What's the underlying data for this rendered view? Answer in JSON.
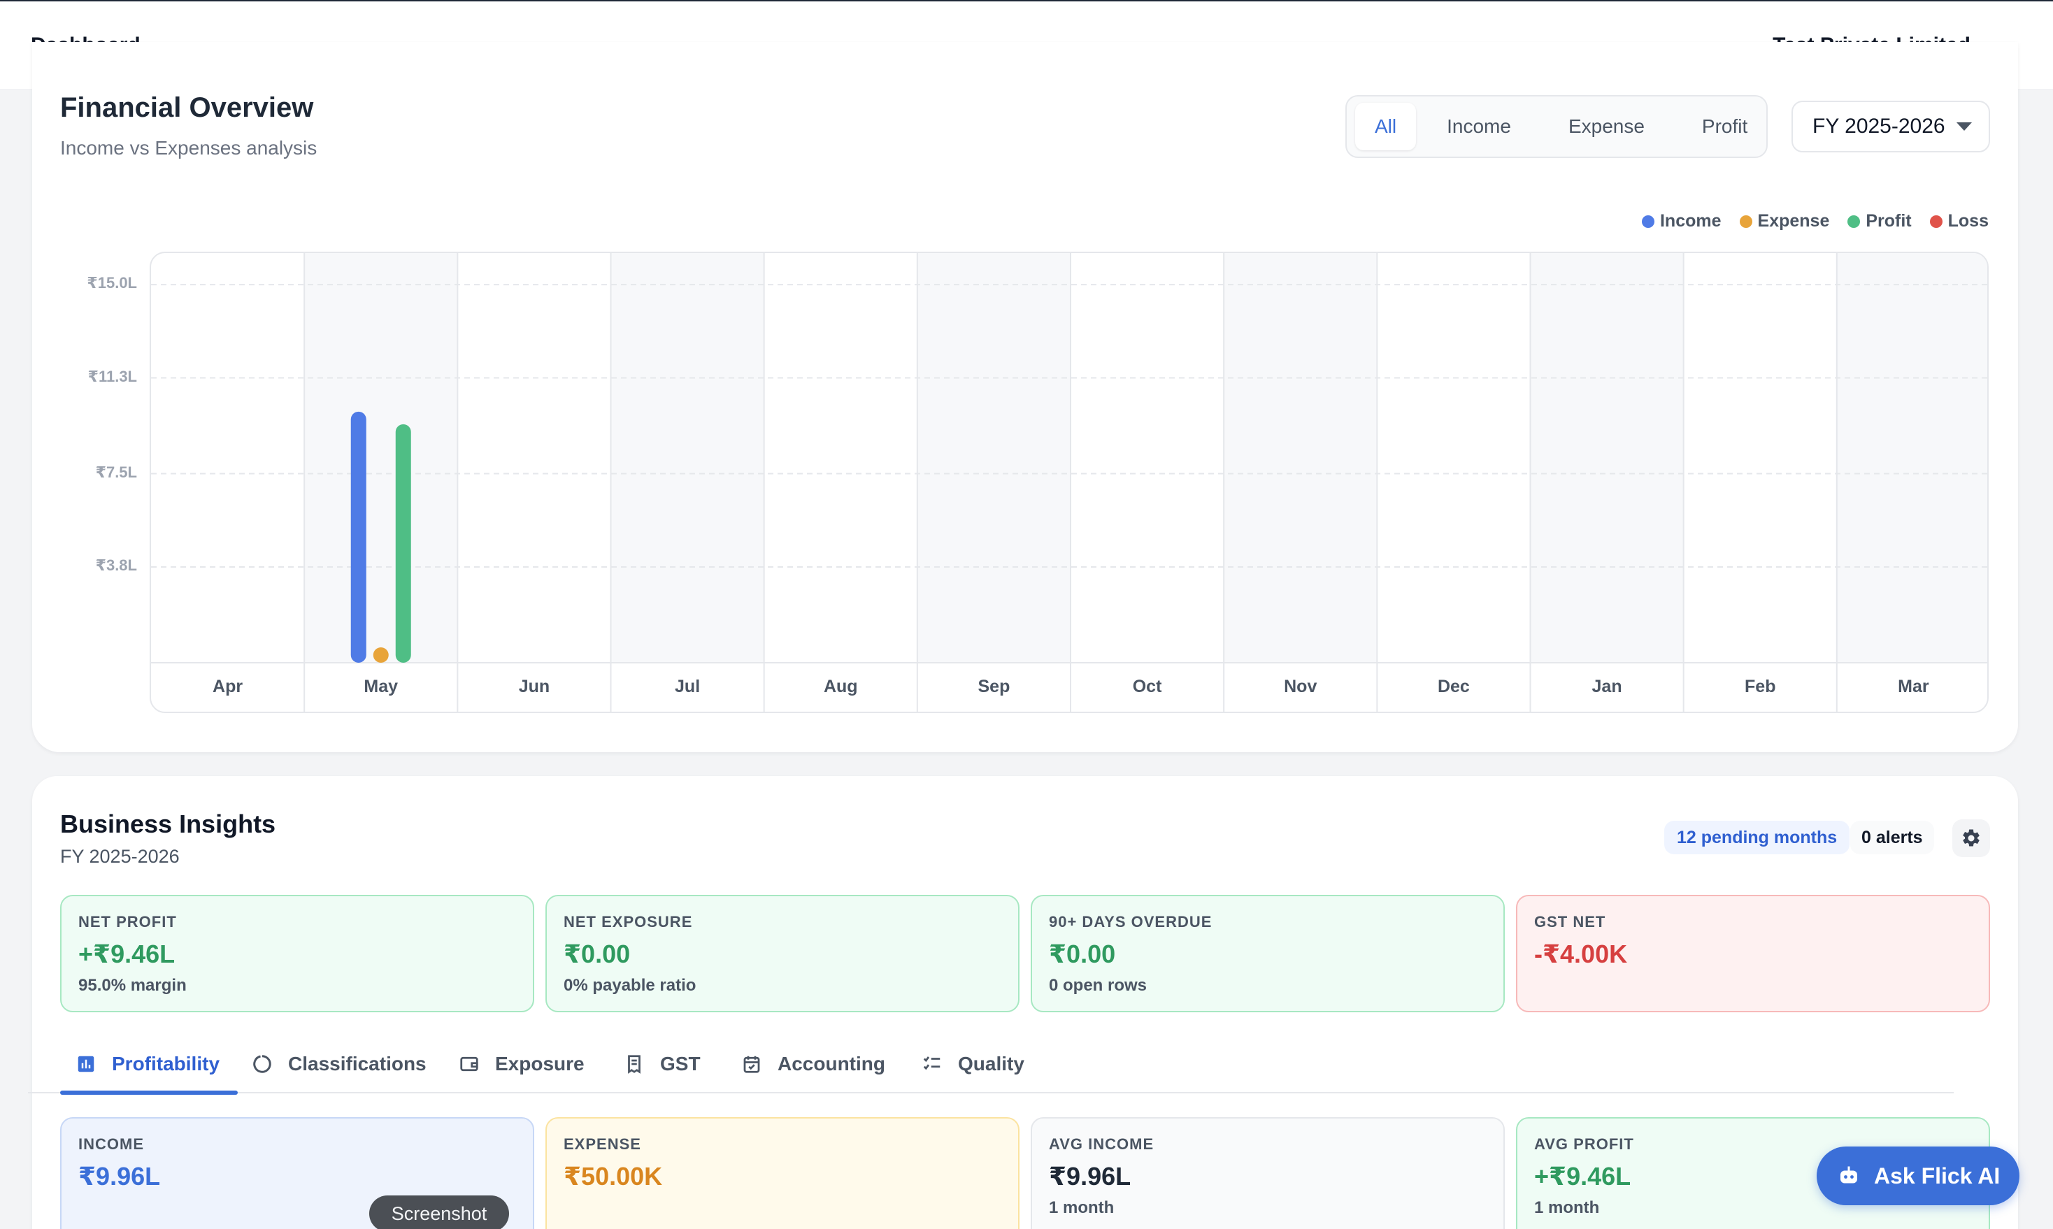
{
  "header": {
    "title": "Dashboard",
    "company": "Test Private Limited"
  },
  "financial_overview": {
    "title": "Financial Overview",
    "subtitle": "Income vs Expenses analysis",
    "filters": [
      "All",
      "Income",
      "Expense",
      "Profit"
    ],
    "active_filter": "All",
    "fiscal_year": "FY 2025-2026"
  },
  "chart_data": {
    "type": "bar",
    "categories": [
      "Apr",
      "May",
      "Jun",
      "Jul",
      "Aug",
      "Sep",
      "Oct",
      "Nov",
      "Dec",
      "Jan",
      "Feb",
      "Mar"
    ],
    "series": [
      {
        "name": "Income",
        "color": "#4f7be6",
        "values": [
          0,
          9.96,
          0,
          0,
          0,
          0,
          0,
          0,
          0,
          0,
          0,
          0
        ]
      },
      {
        "name": "Expense",
        "color": "#e8a43a",
        "values": [
          0,
          0.5,
          0,
          0,
          0,
          0,
          0,
          0,
          0,
          0,
          0,
          0
        ]
      },
      {
        "name": "Profit",
        "color": "#4fbe85",
        "values": [
          0,
          9.46,
          0,
          0,
          0,
          0,
          0,
          0,
          0,
          0,
          0,
          0
        ]
      },
      {
        "name": "Loss",
        "color": "#e0534a",
        "values": [
          0,
          0,
          0,
          0,
          0,
          0,
          0,
          0,
          0,
          0,
          0,
          0
        ]
      }
    ],
    "y_tick_labels": [
      "₹15.0L",
      "₹11.3L",
      "₹7.5L",
      "₹3.8L"
    ],
    "y_ticks": [
      15.0,
      11.3,
      7.5,
      3.8
    ],
    "ylim": [
      0,
      16.25
    ],
    "grid": true,
    "legend_position": "top-right"
  },
  "insights": {
    "title": "Business Insights",
    "subtitle": "FY 2025-2026",
    "pending_badge": "12 pending months",
    "alerts_badge": "0 alerts",
    "cards": [
      {
        "label": "NET PROFIT",
        "value": "+₹9.46L",
        "note": "95.0% margin",
        "value_color": "#2f9a5f"
      },
      {
        "label": "NET EXPOSURE",
        "value": "₹0.00",
        "note": "0% payable ratio",
        "value_color": "#2f9a5f"
      },
      {
        "label": "90+ DAYS OVERDUE",
        "value": "₹0.00",
        "note": "0 open rows",
        "value_color": "#2f9a5f"
      },
      {
        "label": "GST NET",
        "value": "-₹4.00K",
        "note": "",
        "value_color": "#d64040"
      }
    ],
    "tabs": [
      "Profitability",
      "Classifications",
      "Exposure",
      "GST",
      "Accounting",
      "Quality"
    ],
    "active_tab": "Profitability",
    "metric_cards": [
      {
        "label": "INCOME",
        "value": "₹9.96L",
        "note": "",
        "value_color": "#3b6fd8"
      },
      {
        "label": "EXPENSE",
        "value": "₹50.00K",
        "note": "",
        "value_color": "#d9861f"
      },
      {
        "label": "AVG INCOME",
        "value": "₹9.96L",
        "note": "1 month",
        "value_color": "#1f2937"
      },
      {
        "label": "AVG PROFIT",
        "value": "+₹9.46L",
        "note": "1 month",
        "value_color": "#2f9a5f"
      }
    ]
  },
  "ask_ai": {
    "label": "Ask Flick AI"
  },
  "toast": {
    "label": "Screenshot"
  }
}
